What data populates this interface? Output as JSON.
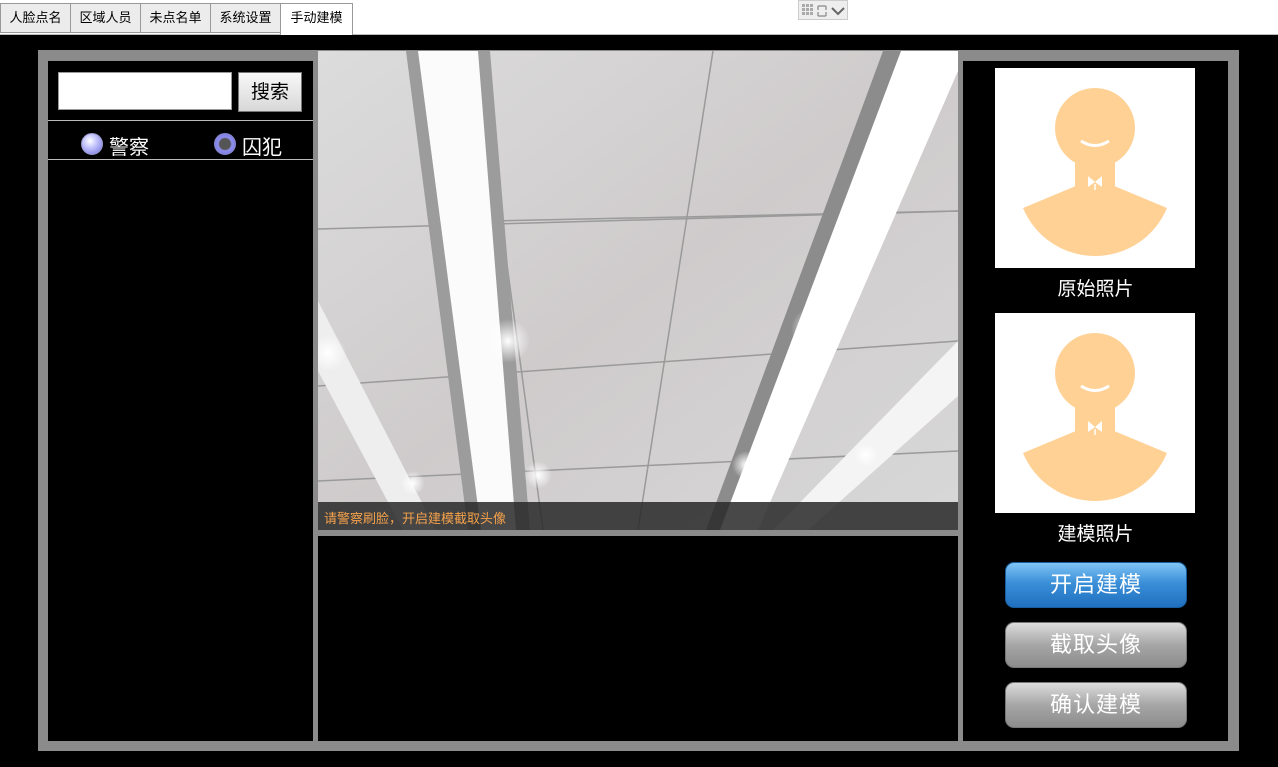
{
  "tabs": [
    {
      "label": "人脸点名",
      "active": false
    },
    {
      "label": "区域人员",
      "active": false
    },
    {
      "label": "未点名单",
      "active": false
    },
    {
      "label": "系统设置",
      "active": false
    },
    {
      "label": "手动建模",
      "active": true
    }
  ],
  "search": {
    "value": "",
    "button_label": "搜索"
  },
  "roles": [
    {
      "label": "警察",
      "selected": false
    },
    {
      "label": "囚犯",
      "selected": true
    }
  ],
  "camera": {
    "caption": "请警察刷脸，开启建模截取头像"
  },
  "photos": {
    "original_label": "原始照片",
    "model_label": "建模照片"
  },
  "buttons": {
    "start_label": "开启建模",
    "capture_label": "截取头像",
    "confirm_label": "确认建模"
  },
  "colors": {
    "avatar": "#ffd195",
    "caption": "#f4a14a",
    "start_button": "#2f86d0"
  }
}
